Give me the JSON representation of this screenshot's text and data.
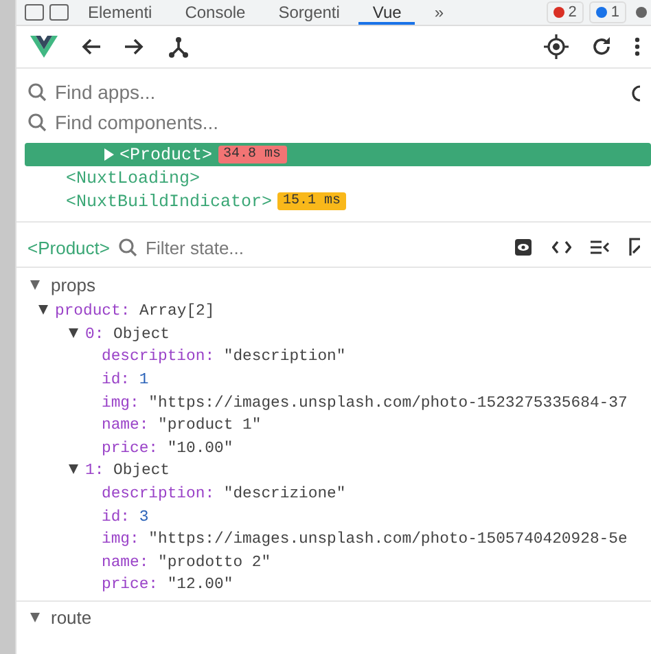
{
  "devtools_tabs": [
    {
      "label": "Elementi",
      "selected": false
    },
    {
      "label": "Console",
      "selected": false
    },
    {
      "label": "Sorgenti",
      "selected": false
    },
    {
      "label": "Vue",
      "selected": true
    },
    {
      "label": "»",
      "selected": false
    }
  ],
  "badges": [
    {
      "kind": "error",
      "count": "2"
    },
    {
      "kind": "message",
      "count": "1"
    }
  ],
  "search_apps": {
    "placeholder": "Find apps..."
  },
  "search_components": {
    "placeholder": "Find components..."
  },
  "component_tree": [
    {
      "name": "<Product>",
      "selected": true,
      "expandable": true,
      "kind": "nested",
      "time": {
        "text": "34.8 ms",
        "color": "#f27474"
      }
    },
    {
      "name": "<NuxtLoading>",
      "selected": false,
      "expandable": false,
      "kind": "root"
    },
    {
      "name": "<NuxtBuildIndicator>",
      "selected": false,
      "expandable": false,
      "kind": "root",
      "time": {
        "text": "15.1 ms",
        "color": "#f9b81a"
      }
    }
  ],
  "inspector": {
    "component": "<Product>",
    "filter": {
      "placeholder": "Filter state..."
    }
  },
  "sections": [
    {
      "title": "props",
      "expanded": true,
      "children": [
        {
          "key": "product:",
          "value": "Array[2]",
          "kind": "plain",
          "expanded": true,
          "children": [
            {
              "key": "0:",
              "value": "Object",
              "kind": "plain",
              "expanded": true,
              "children": [
                {
                  "key": "description:",
                  "value": "\"description\"",
                  "kind": "string"
                },
                {
                  "key": "id:",
                  "value": "1",
                  "kind": "number"
                },
                {
                  "key": "img:",
                  "value": "\"https://images.unsplash.com/photo-1523275335684-37",
                  "kind": "string"
                },
                {
                  "key": "name:",
                  "value": "\"product 1\"",
                  "kind": "string"
                },
                {
                  "key": "price:",
                  "value": "\"10.00\"",
                  "kind": "string"
                }
              ]
            },
            {
              "key": "1:",
              "value": "Object",
              "kind": "plain",
              "expanded": true,
              "children": [
                {
                  "key": "description:",
                  "value": "\"descrizione\"",
                  "kind": "string"
                },
                {
                  "key": "id:",
                  "value": "3",
                  "kind": "number"
                },
                {
                  "key": "img:",
                  "value": "\"https://images.unsplash.com/photo-1505740420928-5e",
                  "kind": "string"
                },
                {
                  "key": "name:",
                  "value": "\"prodotto 2\"",
                  "kind": "string"
                },
                {
                  "key": "price:",
                  "value": "\"12.00\"",
                  "kind": "string"
                }
              ]
            }
          ]
        }
      ]
    },
    {
      "title": "route",
      "expanded": true
    }
  ]
}
